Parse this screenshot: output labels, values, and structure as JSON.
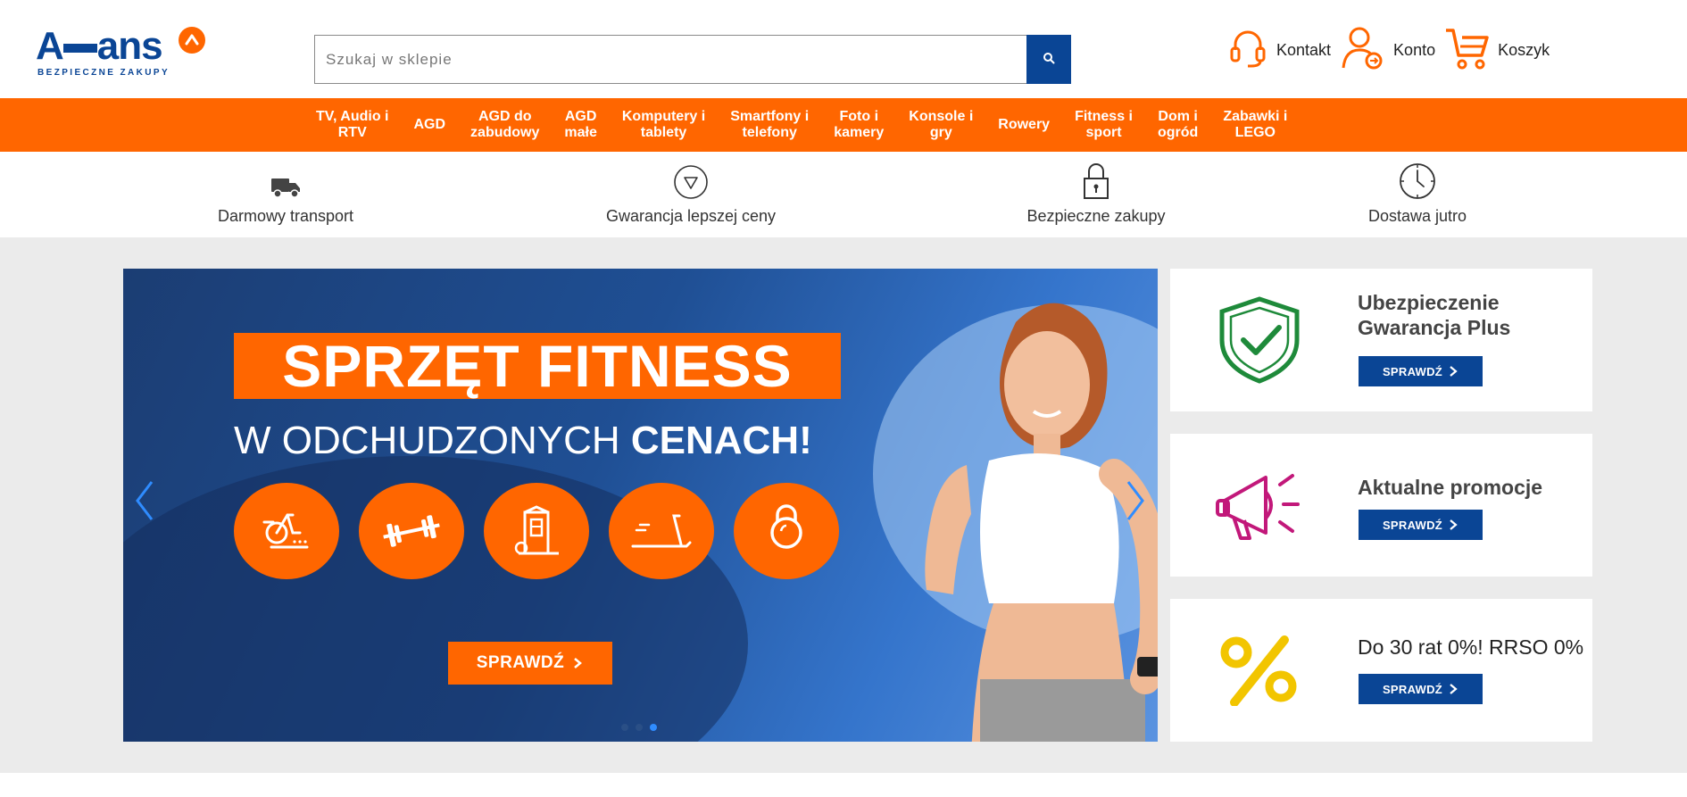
{
  "brand": {
    "name": "Avans",
    "tagline": "BEZPIECZNE ZAKUPY",
    "accent_orange": "#ff6600",
    "brand_blue": "#0a4595"
  },
  "search": {
    "placeholder": "Szukaj w sklepie",
    "value": ""
  },
  "header_links": [
    {
      "label": "Kontakt",
      "icon": "headset-icon"
    },
    {
      "label": "Konto",
      "icon": "user-icon"
    },
    {
      "label": "Koszyk",
      "icon": "cart-icon"
    }
  ],
  "nav": [
    "TV, Audio i\nRTV",
    "AGD",
    "AGD do\nzabudowy",
    "AGD\nmałe",
    "Komputery i\ntablety",
    "Smartfony i\ntelefony",
    "Foto i\nkamery",
    "Konsole i\ngry",
    "Rowery",
    "Fitness i\nsport",
    "Dom i\nogród",
    "Zabawki i\nLEGO"
  ],
  "features": [
    {
      "label": "Darmowy transport",
      "icon": "truck-icon"
    },
    {
      "label": "Gwarancja lepszej ceny",
      "icon": "triangle-badge-icon"
    },
    {
      "label": "Bezpieczne zakupy",
      "icon": "padlock-icon"
    },
    {
      "label": "Dostawa jutro",
      "icon": "clock-icon"
    }
  ],
  "slider": {
    "headline": "SPRZĘT FITNESS",
    "subline_normal": "W ODCHUDZONYCH ",
    "subline_bold": "CENACH!",
    "cta": "SPRAWDŹ",
    "equipment_icons": [
      "exercise-bike-icon",
      "barbell-icon",
      "gym-station-icon",
      "treadmill-icon",
      "kettlebell-icon"
    ],
    "slide_count": 3,
    "active_slide": 3
  },
  "promos": [
    {
      "title_line1": "Ubezpieczenie",
      "title_line2": "Gwarancja Plus",
      "button": "SPRAWDŹ",
      "icon": "shield-check-icon"
    },
    {
      "title_line1": "Aktualne promocje",
      "title_line2": "",
      "button": "SPRAWDŹ",
      "icon": "megaphone-icon"
    },
    {
      "title_line1": "Do 30 rat 0%! RRSO 0%",
      "title_line2": "",
      "button": "SPRAWDŹ",
      "icon": "percent-icon"
    }
  ]
}
